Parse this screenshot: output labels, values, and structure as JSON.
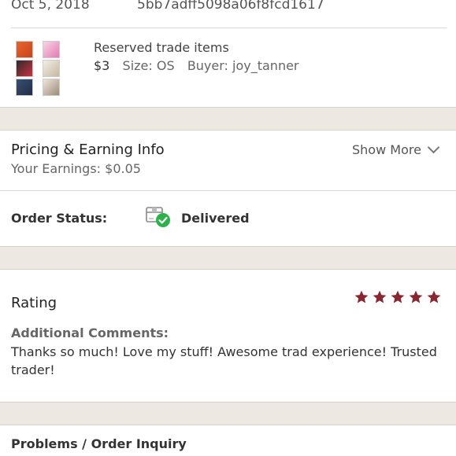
{
  "order": {
    "date": "Oct 5, 2018",
    "id": "5bb7adff5098a06f8fcd1617"
  },
  "item": {
    "title": "Reserved trade items",
    "price": "$3",
    "size_label": "Size: OS",
    "buyer_label": "Buyer: joy_tanner"
  },
  "pricing": {
    "title": "Pricing & Earning Info",
    "earnings": "Your Earnings: $0.05",
    "show_more": "Show More"
  },
  "status": {
    "label": "Order Status:",
    "value": "Delivered",
    "icon": "package-delivered-icon"
  },
  "rating": {
    "title": "Rating",
    "stars": 5,
    "comments_label": "Additional Comments:",
    "comment": "Thanks so much! Love my stuff! Awesome trad experience! Trusted trader!",
    "star_color": "#8a2630"
  },
  "problems": {
    "label": "Problems / Order Inquiry"
  },
  "colors": {
    "check_green": "#2bb34a",
    "gap_background": "#ede8e2"
  }
}
